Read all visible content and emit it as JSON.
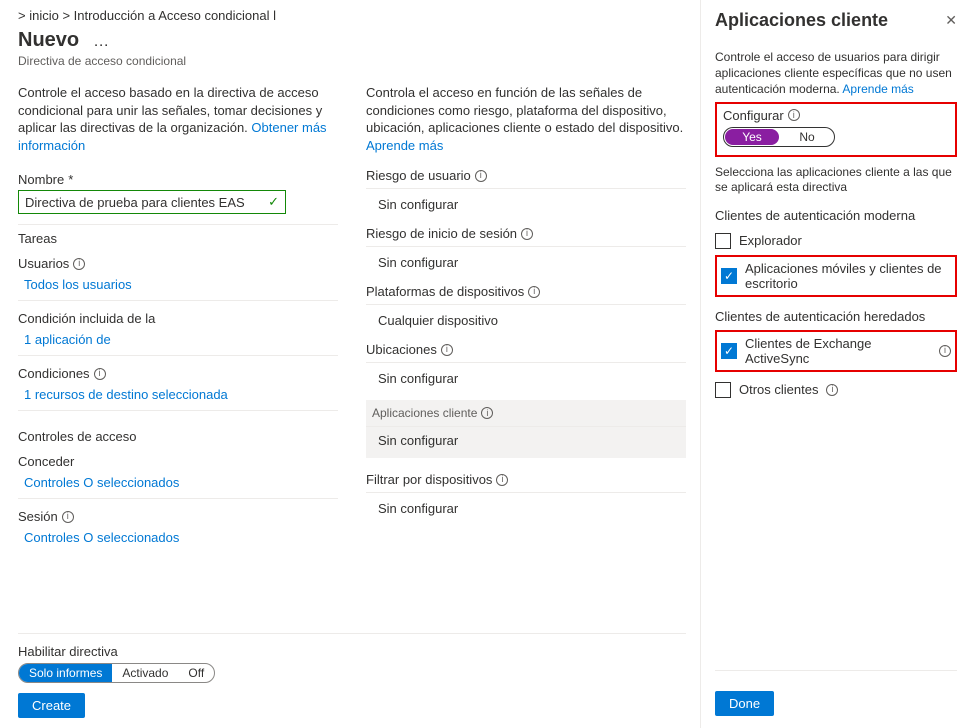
{
  "breadcrumb": "&gt; inicio   &gt; Introducción a Acceso condicional l",
  "page_title": "Nuevo",
  "ellipsis": "…",
  "subtitle": "Directiva de acceso condicional",
  "left": {
    "desc_text": "Controle el acceso basado en la directiva de acceso condicional para unir las señales, tomar decisiones y aplicar las directivas de la organización. ",
    "desc_link": "Obtener más información",
    "name_label": "Nombre",
    "name_value": "Directiva de prueba para clientes EAS",
    "tasks_head": "Tareas",
    "users": {
      "label": "Usuarios",
      "value": "Todos los usuarios"
    },
    "condinc": {
      "label": "Condición incluida de la",
      "value": "1 aplicación de"
    },
    "conditions": {
      "label": "Condiciones",
      "value": "1 recursos de destino seleccionada"
    },
    "access_head": "Controles de acceso",
    "grant": {
      "label": "Conceder",
      "value": "Controles O seleccionados"
    },
    "session": {
      "label": "Sesión",
      "value": "Controles O seleccionados"
    }
  },
  "mid": {
    "desc_text": "Controla el acceso en función de las señales de condiciones como riesgo, plataforma del dispositivo, ubicación, aplicaciones cliente o estado del dispositivo. ",
    "desc_link": "Aprende más",
    "items": [
      {
        "label": "Riesgo de usuario",
        "value": "Sin configurar",
        "info": true
      },
      {
        "label": "Riesgo de inicio de sesión",
        "value": "Sin configurar",
        "info": true
      },
      {
        "label": "Plataformas de dispositivos",
        "value": "Cualquier dispositivo",
        "info": true
      },
      {
        "label": "Ubicaciones",
        "value": "Sin configurar",
        "info": true
      },
      {
        "label": "Aplicaciones cliente",
        "value": "Sin configurar",
        "info": true,
        "active": true
      },
      {
        "label": "Filtrar por dispositivos",
        "value": "Sin configurar",
        "info": true
      }
    ]
  },
  "bottom": {
    "enable_label": "Habilitar directiva",
    "seg": [
      "Solo informes",
      "Activado",
      "Off"
    ],
    "seg_selected": 0,
    "create": "Create"
  },
  "right": {
    "title": "Aplicaciones cliente",
    "desc_text": "Controle el acceso de usuarios para dirigir aplicaciones cliente específicas que no usen autenticación moderna. ",
    "desc_link": "Aprende más",
    "configure_label": "Configurar",
    "toggle_yes": "Yes",
    "toggle_no": "No",
    "select_desc": "Selecciona las aplicaciones cliente a las que se aplicará esta directiva",
    "group1": "Clientes de autenticación moderna",
    "chk1": {
      "label": "Explorador",
      "checked": false
    },
    "chk2": {
      "label": "Aplicaciones móviles y clientes de escritorio",
      "checked": true
    },
    "group2": "Clientes de autenticación heredados",
    "chk3": {
      "label": "Clientes de Exchange ActiveSync",
      "checked": true,
      "info": true
    },
    "chk4": {
      "label": "Otros clientes",
      "checked": false,
      "info": true
    },
    "done": "Done"
  }
}
